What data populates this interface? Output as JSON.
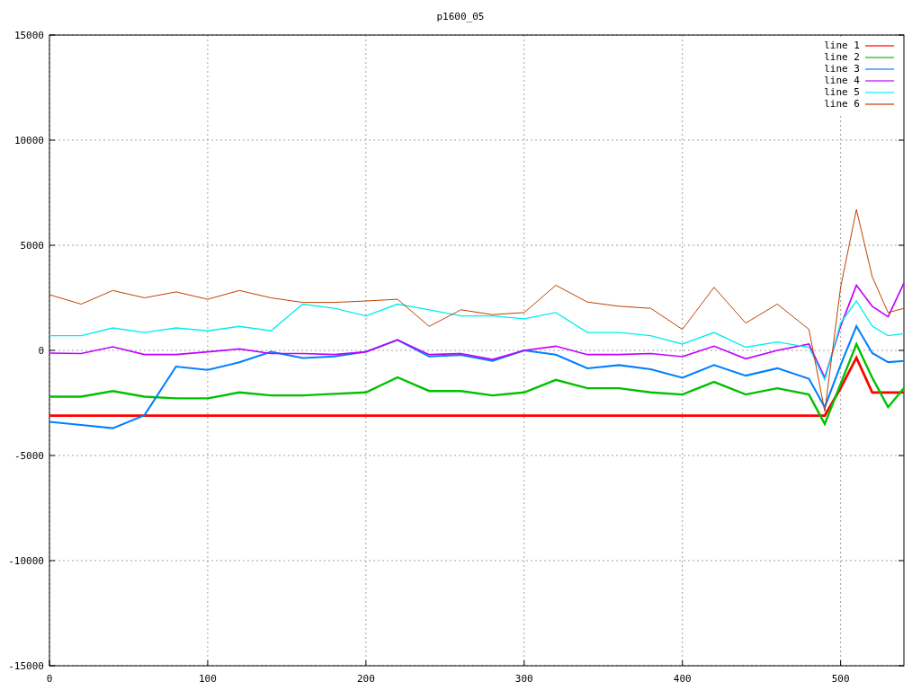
{
  "chart_data": {
    "type": "line",
    "title": "p1600_05",
    "x": [
      0,
      20,
      40,
      60,
      80,
      100,
      120,
      140,
      160,
      180,
      200,
      220,
      240,
      260,
      280,
      300,
      320,
      340,
      360,
      380,
      400,
      420,
      440,
      460,
      480,
      490,
      500,
      510,
      520,
      530,
      540
    ],
    "series": [
      {
        "name": "line 1",
        "color": "#ff0000",
        "values": [
          -3100,
          -3100,
          -3100,
          -3100,
          -3100,
          -3100,
          -3100,
          -3100,
          -3100,
          -3100,
          -3100,
          -3100,
          -3100,
          -3100,
          -3100,
          -3100,
          -3100,
          -3100,
          -3100,
          -3100,
          -3100,
          -3100,
          -3100,
          -3100,
          -3100,
          -3100,
          -1800,
          -350,
          -2000,
          -2000,
          -2000
        ]
      },
      {
        "name": "line 2",
        "color": "#00c000",
        "values": [
          -2200,
          -2200,
          -1930,
          -2200,
          -2280,
          -2280,
          -2000,
          -2140,
          -2140,
          -2070,
          -2000,
          -1280,
          -1930,
          -1930,
          -2140,
          -2000,
          -1400,
          -1800,
          -1800,
          -2000,
          -2100,
          -1500,
          -2100,
          -1800,
          -2100,
          -3500,
          -1600,
          300,
          -1300,
          -2700,
          -1800
        ]
      },
      {
        "name": "line 3",
        "color": "#0080ff",
        "values": [
          -3400,
          -3550,
          -3700,
          -3080,
          -770,
          -930,
          -570,
          -70,
          -360,
          -290,
          -70,
          500,
          -290,
          -220,
          -500,
          0,
          -200,
          -850,
          -700,
          -900,
          -1300,
          -700,
          -1200,
          -850,
          -1350,
          -2700,
          -700,
          1150,
          -130,
          -560,
          -500
        ]
      },
      {
        "name": "line 4",
        "color": "#c000ff",
        "values": [
          -130,
          -150,
          170,
          -200,
          -200,
          -70,
          70,
          -150,
          -150,
          -200,
          -70,
          500,
          -200,
          -150,
          -430,
          0,
          200,
          -200,
          -200,
          -150,
          -300,
          200,
          -400,
          0,
          300,
          -1300,
          1150,
          3100,
          2100,
          1600,
          3200
        ]
      },
      {
        "name": "line 5",
        "color": "#00eeee",
        "values": [
          700,
          700,
          1070,
          850,
          1070,
          930,
          1140,
          930,
          2200,
          2000,
          1640,
          2200,
          1930,
          1640,
          1640,
          1500,
          1800,
          850,
          850,
          700,
          300,
          850,
          150,
          400,
          150,
          -1400,
          1300,
          2350,
          1150,
          700,
          800
        ]
      },
      {
        "name": "line 6",
        "color": "#c04000",
        "values": [
          2650,
          2200,
          2850,
          2500,
          2780,
          2430,
          2850,
          2500,
          2280,
          2280,
          2350,
          2430,
          1140,
          1930,
          1700,
          1800,
          3100,
          2300,
          2100,
          2000,
          1000,
          3000,
          1300,
          2200,
          1000,
          -2900,
          3000,
          6700,
          3500,
          1800,
          2000
        ]
      }
    ],
    "xlim": [
      0,
      540
    ],
    "ylim": [
      -15000,
      15000
    ],
    "xticks": [
      0,
      100,
      200,
      300,
      400,
      500
    ],
    "yticks": [
      -15000,
      -10000,
      -5000,
      0,
      5000,
      10000,
      15000
    ],
    "grid": true,
    "legend": true
  }
}
